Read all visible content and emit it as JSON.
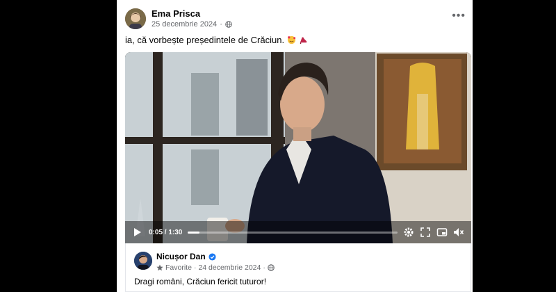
{
  "post": {
    "author": "Ema Prisca",
    "date": "25 decembrie 2024",
    "text": "ia, că vorbește președintele de Crăciun.",
    "privacy_icon": "globe-icon",
    "emojis": [
      "smiling-face-with-hearts-icon",
      "high-heel-icon"
    ]
  },
  "video": {
    "time": "0:05 / 1:30",
    "progress": 0.055
  },
  "shared": {
    "author": "Nicușor Dan",
    "verified": true,
    "meta_label": "Favorite",
    "date": "24 decembrie 2024",
    "text": "Dragi români, Crăciun fericit tuturor!"
  },
  "colors": {
    "accent_verified": "#1877f2",
    "meta_text": "#65676b"
  }
}
